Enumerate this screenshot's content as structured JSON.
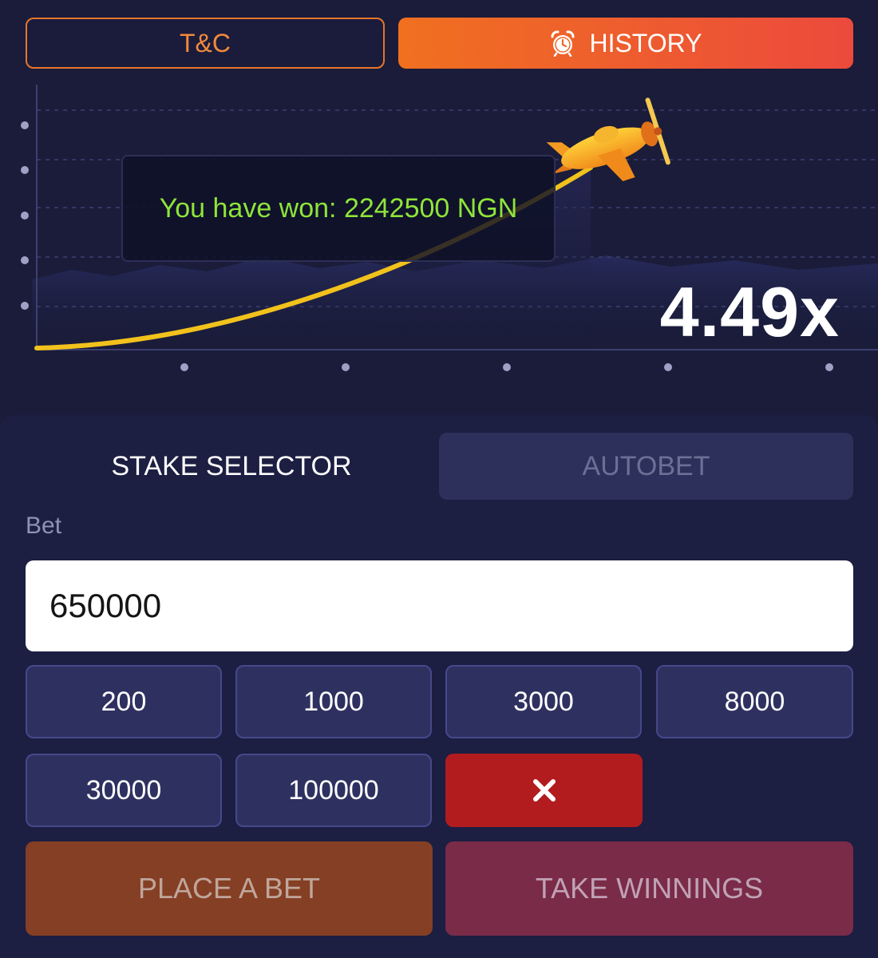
{
  "header": {
    "tc_label": "T&C",
    "history_label": "HISTORY",
    "history_icon": "alarm-clock-icon"
  },
  "game": {
    "win_message": "You have won: 2242500 NGN",
    "multiplier": "4.49x",
    "plane_icon": "airplane-icon"
  },
  "bet_panel": {
    "tabs": {
      "stake_selector": "STAKE SELECTOR",
      "autobet": "AUTOBET"
    },
    "bet_label": "Bet",
    "bet_value": "650000",
    "chips": [
      "200",
      "1000",
      "3000",
      "8000",
      "30000",
      "100000"
    ],
    "clear_icon": "close-icon",
    "place_bet_label": "PLACE A BET",
    "take_winnings_label": "TAKE WINNINGS"
  },
  "colors": {
    "accent_orange": "#f07020",
    "accent_red": "#ec4a3c",
    "win_text": "#8fe43a",
    "curve": "#f2c21c",
    "clear_button": "#b21c1e"
  }
}
